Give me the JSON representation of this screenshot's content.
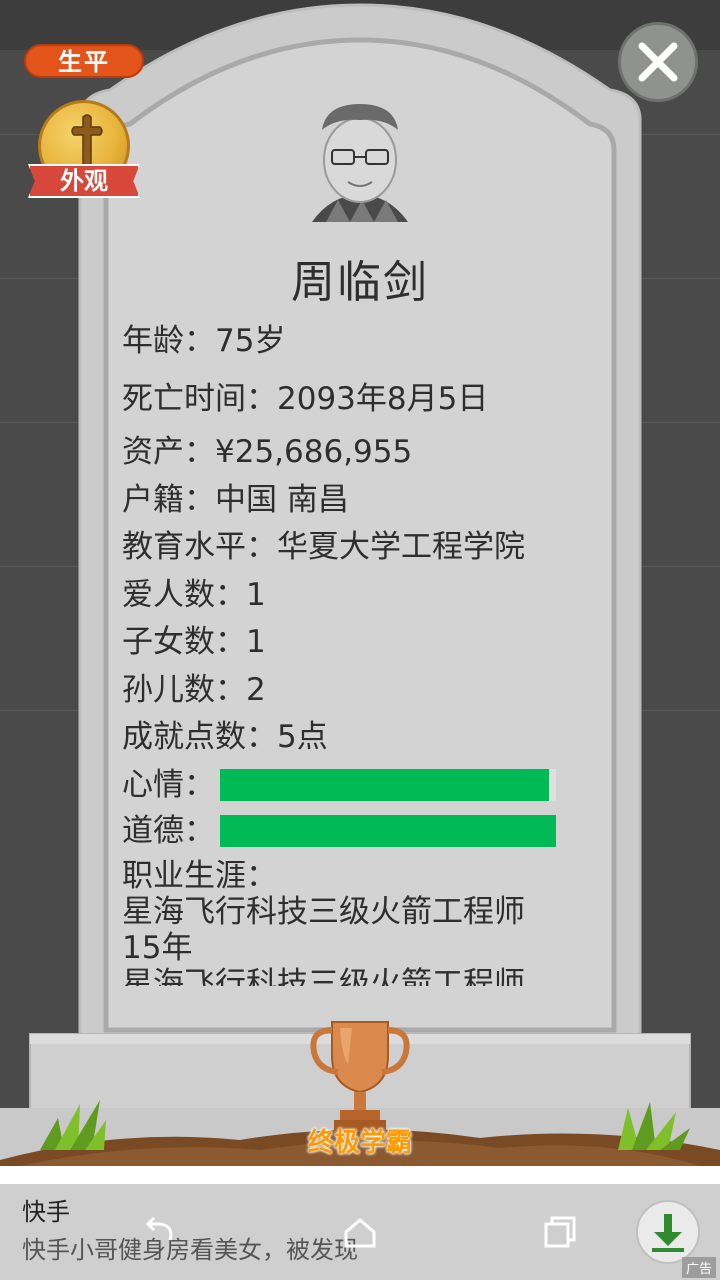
{
  "header": {
    "tab_label": "生平",
    "appearance_label": "外观"
  },
  "profile": {
    "name": "周临剑",
    "age": "年龄：75岁",
    "death_time": "死亡时间：2093年8月5日",
    "assets": "资产：¥25,686,955",
    "hukou": "户籍：中国 南昌",
    "education": "教育水平：华夏大学工程学院",
    "lovers": "爱人数：1",
    "children": "子女数：1",
    "grandchildren": "孙儿数：2",
    "achievement_points": "成就点数：5点",
    "mood_label": "心情：",
    "mood_level": 0.98,
    "morality_label": "道德：",
    "morality_level": 1.0,
    "career_label": "职业生涯：",
    "career_entries": [
      "星海飞行科技三级火箭工程师",
      "15年",
      "星海飞行科技三级火箭工程师"
    ]
  },
  "achievement": {
    "title": "终极学霸"
  },
  "ad": {
    "title": "快手",
    "description": "快手小哥健身房看美女，被发现",
    "tag": "广告"
  },
  "colors": {
    "stone": "#d6d6d6",
    "bar_green": "#00bb55",
    "achievement_orange": "#ff9a00",
    "tab_orange": "#e2541a"
  }
}
